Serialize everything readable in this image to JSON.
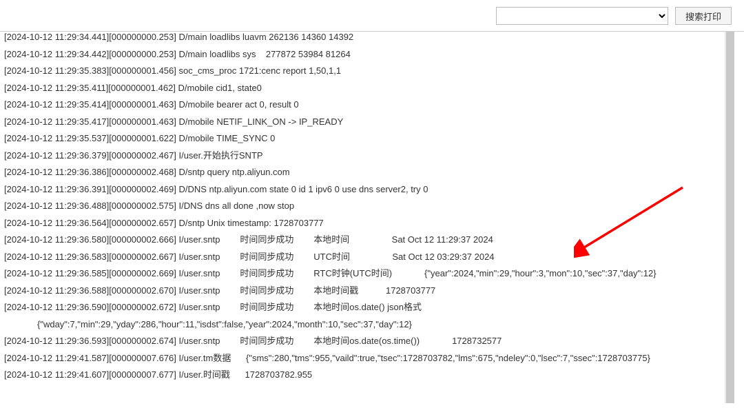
{
  "toolbar": {
    "search_value": "",
    "search_button_label": "搜索打印"
  },
  "log_rows": [
    {
      "text": "[2024-10-12 11:29:34.441][000000000.253] D/main loadlibs luavm 262136 14360 14392",
      "cls": "first"
    },
    {
      "text": "[2024-10-12 11:29:34.442][000000000.253] D/main loadlibs sys    277872 53984 81264"
    },
    {
      "text": "[2024-10-12 11:29:35.383][000000001.456] soc_cms_proc 1721:cenc report 1,50,1,1"
    },
    {
      "text": "[2024-10-12 11:29:35.411][000000001.462] D/mobile cid1, state0"
    },
    {
      "text": "[2024-10-12 11:29:35.414][000000001.463] D/mobile bearer act 0, result 0"
    },
    {
      "text": "[2024-10-12 11:29:35.417][000000001.463] D/mobile NETIF_LINK_ON -> IP_READY"
    },
    {
      "text": "[2024-10-12 11:29:35.537][000000001.622] D/mobile TIME_SYNC 0"
    },
    {
      "text": "[2024-10-12 11:29:36.379][000000002.467] I/user.开始执行SNTP"
    },
    {
      "text": "[2024-10-12 11:29:36.386][000000002.468] D/sntp query ntp.aliyun.com"
    },
    {
      "text": "[2024-10-12 11:29:36.391][000000002.469] D/DNS ntp.aliyun.com state 0 id 1 ipv6 0 use dns server2, try 0"
    },
    {
      "text": "[2024-10-12 11:29:36.488][000000002.575] I/DNS dns all done ,now stop"
    },
    {
      "text": "[2024-10-12 11:29:36.564][000000002.657] D/sntp Unix timestamp: 1728703777"
    },
    {
      "text": "[2024-10-12 11:29:36.580][000000002.666] I/user.sntp        时间同步成功        本地时间                 Sat Oct 12 11:29:37 2024"
    },
    {
      "text": "[2024-10-12 11:29:36.583][000000002.667] I/user.sntp        时间同步成功        UTC时间                 Sat Oct 12 03:29:37 2024"
    },
    {
      "text": "[2024-10-12 11:29:36.585][000000002.669] I/user.sntp        时间同步成功        RTC时钟(UTC时间)             {\"year\":2024,\"min\":29,\"hour\":3,\"mon\":10,\"sec\":37,\"day\":12}"
    },
    {
      "text": "[2024-10-12 11:29:36.588][000000002.670] I/user.sntp        时间同步成功        本地时间戳           1728703777"
    },
    {
      "text": "[2024-10-12 11:29:36.590][000000002.672] I/user.sntp        时间同步成功        本地时间os.date() json格式"
    },
    {
      "text": "{\"wday\":7,\"min\":29,\"yday\":286,\"hour\":11,\"isdst\":false,\"year\":2024,\"month\":10,\"sec\":37,\"day\":12}",
      "cls": "indent"
    },
    {
      "text": "[2024-10-12 11:29:36.593][000000002.674] I/user.sntp        时间同步成功        本地时间os.date(os.time())             1728732577"
    },
    {
      "text": "[2024-10-12 11:29:41.587][000000007.676] I/user.tm数据      {\"sms\":280,\"tms\":955,\"vaild\":true,\"tsec\":1728703782,\"lms\":675,\"ndeley\":0,\"lsec\":7,\"ssec\":1728703775}"
    },
    {
      "text": "[2024-10-12 11:29:41.607][000000007.677] I/user.时间戳      1728703782.955"
    }
  ],
  "annotation": {
    "arrow_color": "#ff0000"
  }
}
